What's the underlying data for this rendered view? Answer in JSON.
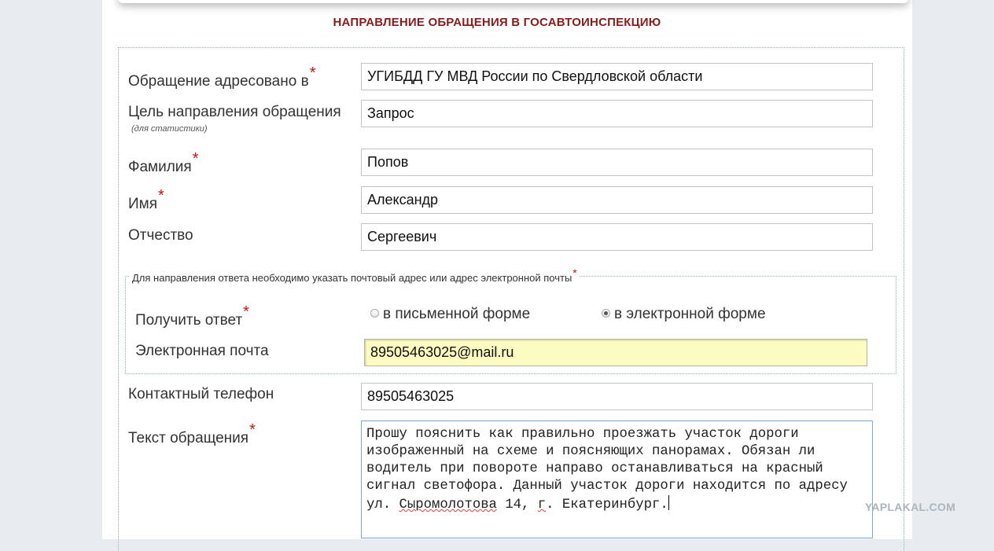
{
  "page": {
    "title": "НАПРАВЛЕНИЕ ОБРАЩЕНИЯ В ГОСАВТОИНСПЕКЦИЮ"
  },
  "form": {
    "addressee": {
      "label": "Обращение адресовано в",
      "required": "*",
      "value": "УГИБДД ГУ МВД России по Свердловской области"
    },
    "purpose": {
      "label": "Цель направления обращения",
      "hint": "(для статистики)",
      "value": "Запрос"
    },
    "last_name": {
      "label": "Фамилия",
      "required": "*",
      "value": "Попов"
    },
    "first_name": {
      "label": "Имя",
      "required": "*",
      "value": "Александр"
    },
    "patronymic": {
      "label": "Отчество",
      "value": "Сергеевич"
    },
    "response": {
      "legend": "Для направления ответа необходимо указать почтовый адрес или адрес электронной почты",
      "legend_required": "*",
      "method_label": "Получить ответ",
      "method_required": "*",
      "option_paper": "в письменной форме",
      "option_electronic": "в электронной форме",
      "selected": "в электронной форме",
      "email_label": "Электронная почта",
      "email_value": "89505463025@mail.ru"
    },
    "phone": {
      "label": "Контактный телефон",
      "value": "89505463025"
    },
    "message": {
      "label": "Текст обращения",
      "required": "*",
      "line1": "Прошу пояснить как правильно проезжать участок дороги",
      "line2": "изображенный на схеме и поясняющих панорамах. Обязан ли",
      "line3": "водитель при повороте направо останавливаться на красный",
      "line4": "сигнал светофора. Данный участок дороги находится по адресу",
      "line5_a": "ул. ",
      "line5_b": "Сыромолотова",
      "line5_c": " 14, ",
      "line5_d": "г",
      "line5_e": ". Екатеринбург."
    }
  },
  "watermark": "YAPLAKAL.COM",
  "colors": {
    "title": "#8b1a1a",
    "required": "#cc1111",
    "email_bg": "#fbfbc2",
    "frame": "#8fb5b5"
  }
}
